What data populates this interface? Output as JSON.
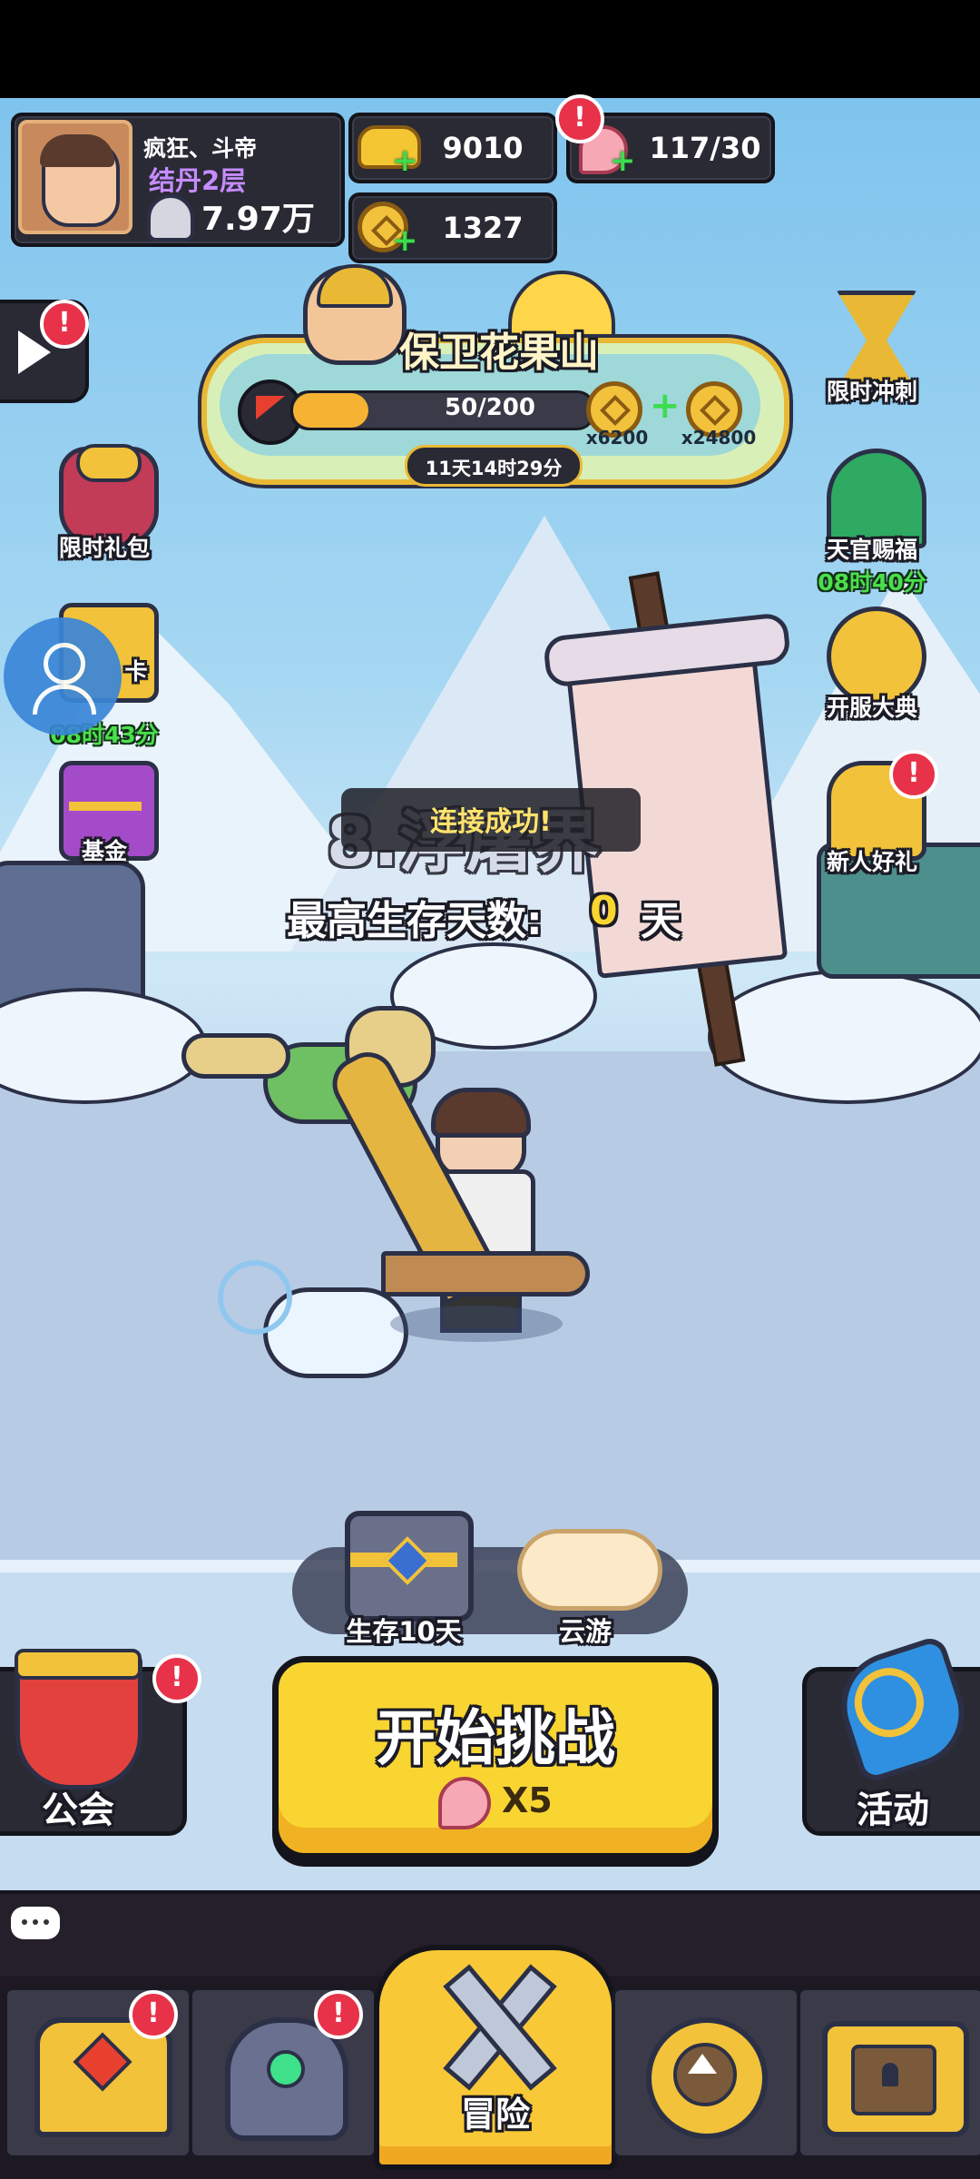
{
  "player": {
    "name": "疯狂、斗帝",
    "realm": "结丹2层",
    "power": "7.97万"
  },
  "resources": {
    "gold": "9010",
    "coins": "1327",
    "stamina": "117/30"
  },
  "event": {
    "title": "保卫花果山",
    "progress_text": "50/200",
    "progress": 0.25,
    "reward_1": "x6200",
    "reward_2": "x24800",
    "countdown": "11天14时29分"
  },
  "left_menu": {
    "gift_pack": "限时礼包",
    "card_label": "卡",
    "card_timer": "08时43分",
    "fund": "基金"
  },
  "right_menu": {
    "sprint": "限时冲刺",
    "blessing": "天官赐福",
    "blessing_timer": "08时40分",
    "celebration": "开服大典",
    "newbie": "新人好礼"
  },
  "stage": {
    "name": "8.浮屠界",
    "toast": "连接成功!",
    "survival_label": "最高生存天数:",
    "survival_days": "0",
    "survival_unit": "天"
  },
  "rewards": {
    "chest_label": "生存10天",
    "cloud_label": "云游"
  },
  "actions": {
    "guild": "公会",
    "start": "开始挑战",
    "cost": "X5",
    "activity": "活动"
  },
  "nav": {
    "adventure": "冒险"
  },
  "colors": {
    "accent_yellow": "#f8d531",
    "progress_fill": "#f6b233",
    "timer_green": "#4be04b",
    "badge_red": "#e8324a",
    "realm_purple": "#c68cff"
  }
}
